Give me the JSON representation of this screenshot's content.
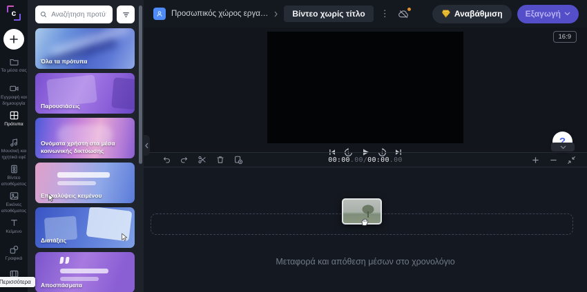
{
  "colors": {
    "accent_purple": "#544ec9",
    "export_text": "#b9b2f2",
    "gem_gold": "#f0c43e",
    "avatar_blue": "#4e8bf5",
    "sync_badge_orange": "#dd8f2d",
    "help_blue": "#4a66e8"
  },
  "sidebar": {
    "items": [
      {
        "label": "Τα μέσα σας",
        "icon": "folder-icon"
      },
      {
        "label": "Εγγραφή και δημιουργία",
        "icon": "camera-icon"
      },
      {
        "label": "Πρότυπα",
        "icon": "templates-icon",
        "active": true
      },
      {
        "label": "Μουσική και ηχητικά εφέ",
        "icon": "music-icon"
      },
      {
        "label": "Βίντεο αποθέματος",
        "icon": "stock-video-icon"
      },
      {
        "label": "Εικόνες αποθέματος",
        "icon": "stock-images-icon"
      },
      {
        "label": "Κείμενο",
        "icon": "text-icon"
      },
      {
        "label": "Γραφικά",
        "icon": "graphics-icon"
      }
    ],
    "more_tooltip": "Περισσότερα"
  },
  "templates": {
    "search_placeholder": "Αναζήτηση προτύπων",
    "cards": [
      {
        "label": "Όλα τα πρότυπα"
      },
      {
        "label": "Παρουσιάσεις"
      },
      {
        "label": "Ονόματα χρήστη στα μέσα κοινωνικής δικτύωσης"
      },
      {
        "label": "Επικαλύψεις κειμένου"
      },
      {
        "label": "Διατάξεις"
      },
      {
        "label": "Αποσπάσματα"
      }
    ]
  },
  "header": {
    "workspace": "Προσωπικός χώρος εργα…",
    "title": "Βίντεο χωρίς τίτλο",
    "upgrade": "Αναβάθμιση",
    "export": "Εξαγωγή"
  },
  "preview": {
    "aspect_ratio": "16:9",
    "help_label": "?"
  },
  "timeline": {
    "timecode": {
      "elapsed": "00:00",
      "elapsed_fraction": ".00",
      "separator": " / ",
      "total": "00:00",
      "total_fraction": ".00"
    },
    "hint": "Μεταφορά και απόθεση μέσων στο χρονολόγιο"
  }
}
